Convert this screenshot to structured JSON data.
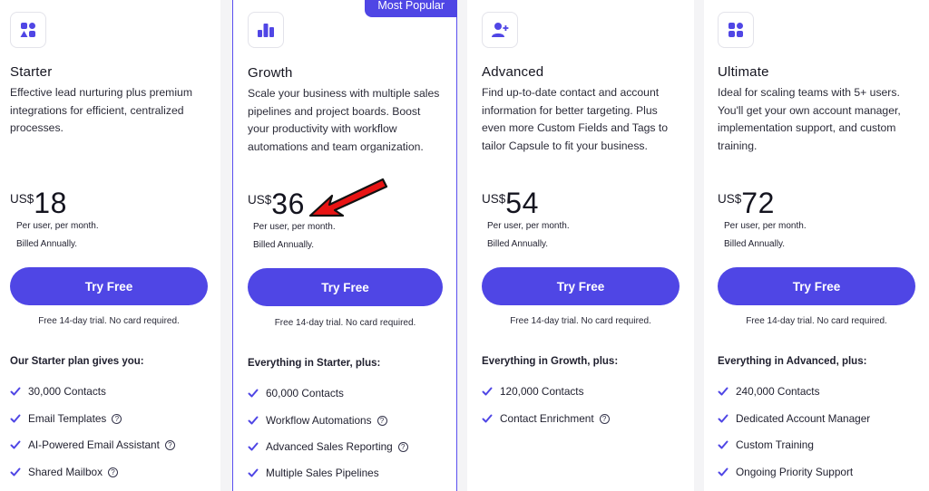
{
  "colors": {
    "accent": "#4f46e5",
    "card_bg": "#ffffff",
    "page_bg": "#f4f4f6"
  },
  "badge": "Most Popular",
  "plans": [
    {
      "icon": "apps-icon",
      "name": "Starter",
      "desc": [
        "Effective lead nurturing plus premium",
        "integrations for efficient, centralized",
        "processes."
      ],
      "currency": "US$",
      "price": "18",
      "per": "Per user, per month.",
      "billing": "Billed Annually.",
      "cta": "Try Free",
      "trial": "Free 14-day trial. No card required.",
      "features_title": "Our Starter plan gives you:",
      "features": [
        {
          "label": "30,000 Contacts",
          "help": false
        },
        {
          "label": "Email Templates",
          "help": true
        },
        {
          "label": "AI-Powered Email Assistant",
          "help": true
        },
        {
          "label": "Shared Mailbox",
          "help": true
        }
      ]
    },
    {
      "icon": "bar-chart-icon",
      "name": "Growth",
      "desc": [
        "Scale your business with multiple sales",
        "pipelines and project boards. Boost",
        "your productivity with workflow",
        "automations and team organization."
      ],
      "currency": "US$",
      "price": "36",
      "per": "Per user, per month.",
      "billing": "Billed Annually.",
      "cta": "Try Free",
      "trial": "Free 14-day trial. No card required.",
      "features_title": "Everything in Starter, plus:",
      "features": [
        {
          "label": "60,000 Contacts",
          "help": false
        },
        {
          "label": "Workflow Automations",
          "help": true
        },
        {
          "label": "Advanced Sales Reporting",
          "help": true
        },
        {
          "label": "Multiple Sales Pipelines",
          "help": false
        }
      ]
    },
    {
      "icon": "user-add-icon",
      "name": "Advanced",
      "desc": [
        "Find up-to-date contact and account",
        "information for better targeting. Plus",
        "even more Custom Fields and Tags to",
        "tailor Capsule to fit your business."
      ],
      "currency": "US$",
      "price": "54",
      "per": "Per user, per month.",
      "billing": "Billed Annually.",
      "cta": "Try Free",
      "trial": "Free 14-day trial. No card required.",
      "features_title": "Everything in Growth, plus:",
      "features": [
        {
          "label": "120,000 Contacts",
          "help": false
        },
        {
          "label": "Contact Enrichment",
          "help": true
        }
      ]
    },
    {
      "icon": "grid-icon",
      "name": "Ultimate",
      "desc": [
        "Ideal for scaling teams with 5+ users.",
        "You'll get your own account manager,",
        "implementation support, and custom",
        "training."
      ],
      "currency": "US$",
      "price": "72",
      "per": "Per user, per month.",
      "billing": "Billed Annually.",
      "cta": "Try Free",
      "trial": "Free 14-day trial. No card required.",
      "features_title": "Everything in Advanced, plus:",
      "features": [
        {
          "label": "240,000 Contacts",
          "help": false
        },
        {
          "label": "Dedicated Account Manager",
          "help": false
        },
        {
          "label": "Custom Training",
          "help": false
        },
        {
          "label": "Ongoing Priority Support",
          "help": false
        }
      ]
    }
  ]
}
